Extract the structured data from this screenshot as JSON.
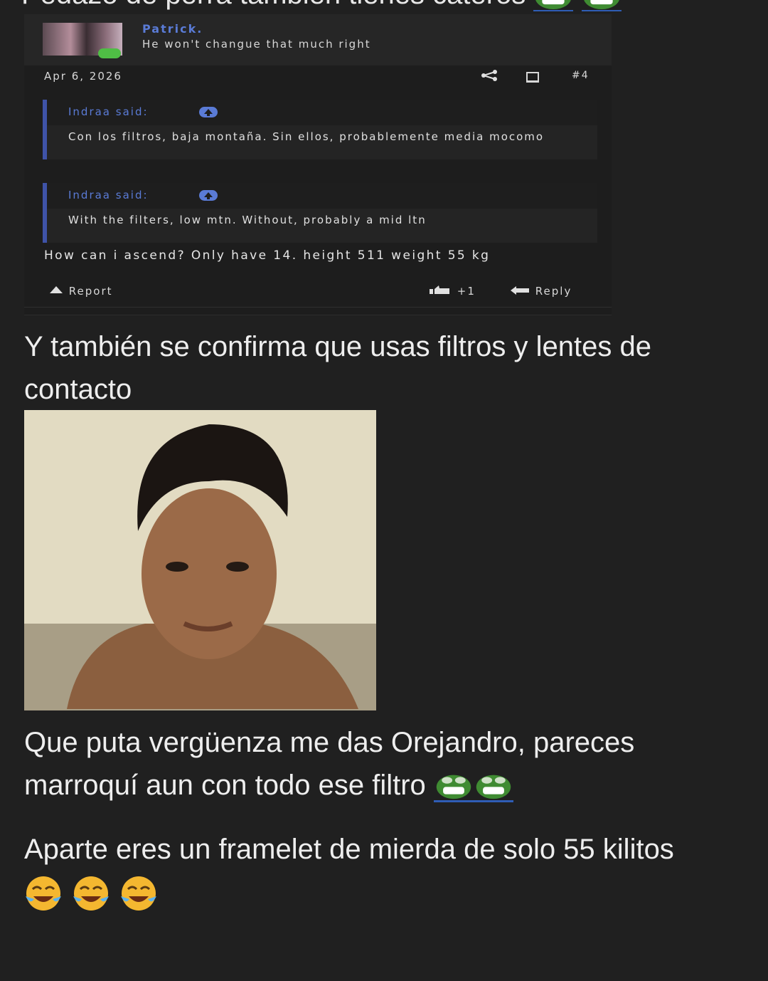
{
  "header_partial_text": "Pedazo de perra también tienes cateros",
  "screenshot": {
    "username": "Patrick.",
    "user_message": "He won't changue that much right",
    "date": "Apr 6, 2026",
    "post_number": "#4",
    "quotes": [
      {
        "author": "Indraa said:",
        "text": "Con los filtros, baja montaña. Sin ellos, probablemente media mocomo"
      },
      {
        "author": "Indraa said:",
        "text": "With the filters, low mtn. Without, probably a mid ltn"
      }
    ],
    "post_text": "How can i ascend? Only have 14. height 511 weight 55 kg",
    "report_label": "Report",
    "like_count": "+1",
    "reply_label": "Reply"
  },
  "message": {
    "line1": "Y también se confirma que usas filtros y lentes de contacto",
    "line2": "Que puta vergüenza me das Orejandro, pareces marroquí aun con todo ese filtro",
    "line3": "Aparte eres un framelet de mierda de solo 55 kilitos"
  },
  "icons": [
    "pepe-laugh-icon",
    "crying-laugh-emoji",
    "share-icon",
    "bookmark-icon",
    "report-icon",
    "like-icon",
    "reply-icon",
    "quote-arrow-icon"
  ]
}
